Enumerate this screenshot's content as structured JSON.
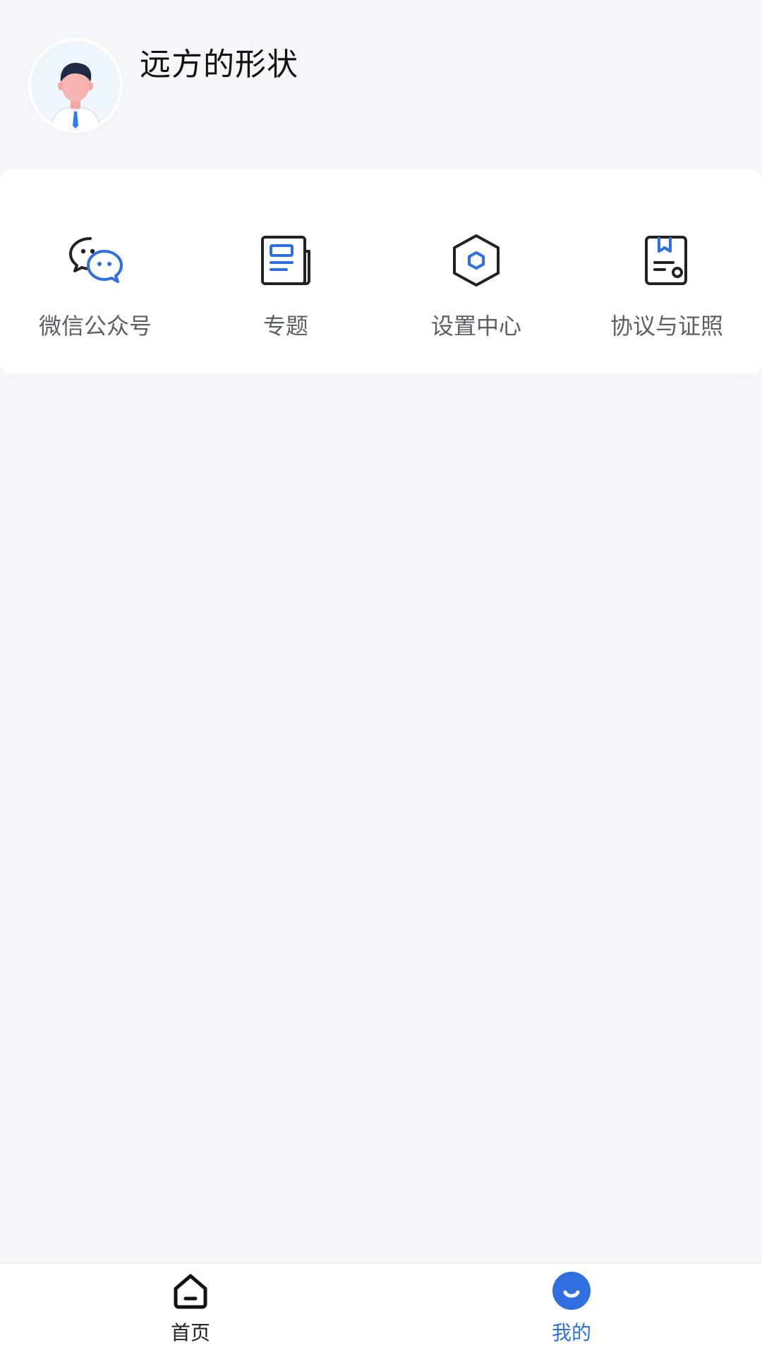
{
  "profile": {
    "username": "远方的形状",
    "avatar_icon": "user-avatar-icon"
  },
  "menu": [
    {
      "label": "微信公众号",
      "icon": "wechat-icon"
    },
    {
      "label": "专题",
      "icon": "newspaper-icon"
    },
    {
      "label": "设置中心",
      "icon": "hexagon-settings-icon"
    },
    {
      "label": "协议与证照",
      "icon": "certificate-document-icon"
    }
  ],
  "tabbar": {
    "home_label": "首页",
    "mine_label": "我的",
    "active": "我的",
    "active_color": "#2f6fe0"
  },
  "colors": {
    "accent": "#2f6fe0",
    "background": "#f4f6fa"
  }
}
